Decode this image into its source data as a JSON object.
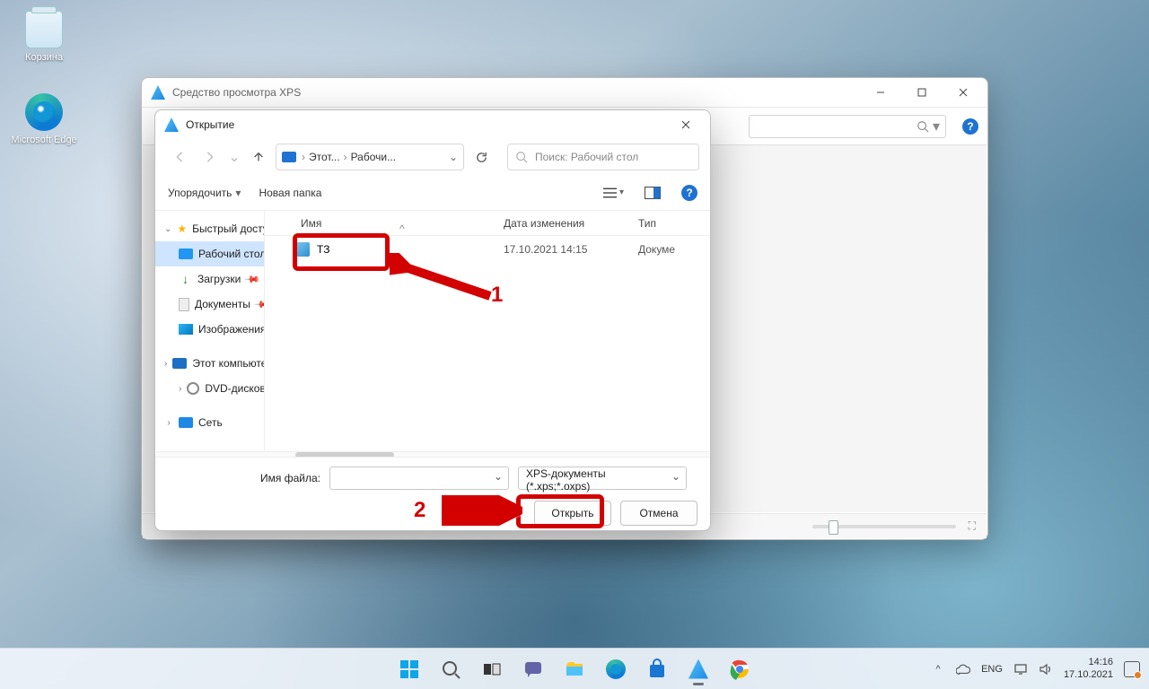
{
  "desktop": {
    "recycle_bin": "Корзина",
    "edge": "Microsoft Edge"
  },
  "xps_window": {
    "title": "Средство просмотра XPS"
  },
  "open_dialog": {
    "title": "Открытие",
    "breadcrumb": {
      "part1": "Этот...",
      "part2": "Рабочи..."
    },
    "search_placeholder": "Поиск: Рабочий стол",
    "organize": "Упорядочить",
    "new_folder": "Новая папка",
    "nav": [
      "Быстрый доступ",
      "Рабочий стол",
      "Загрузки",
      "Документы",
      "Изображения",
      "Этот компьютер",
      "DVD-дисковод (I",
      "Сеть"
    ],
    "cols": {
      "name": "Имя",
      "date": "Дата изменения",
      "type": "Тип"
    },
    "files": [
      {
        "name": "ТЗ",
        "date": "17.10.2021 14:15",
        "type": "Докуме"
      }
    ],
    "filename_label": "Имя файла:",
    "filetype": "XPS-документы (*.xps;*.oxps)",
    "open_btn": "Открыть",
    "cancel_btn": "Отмена"
  },
  "callouts": {
    "one": "1",
    "two": "2"
  },
  "taskbar": {
    "lang": "ENG",
    "time": "14:16",
    "date": "17.10.2021"
  }
}
